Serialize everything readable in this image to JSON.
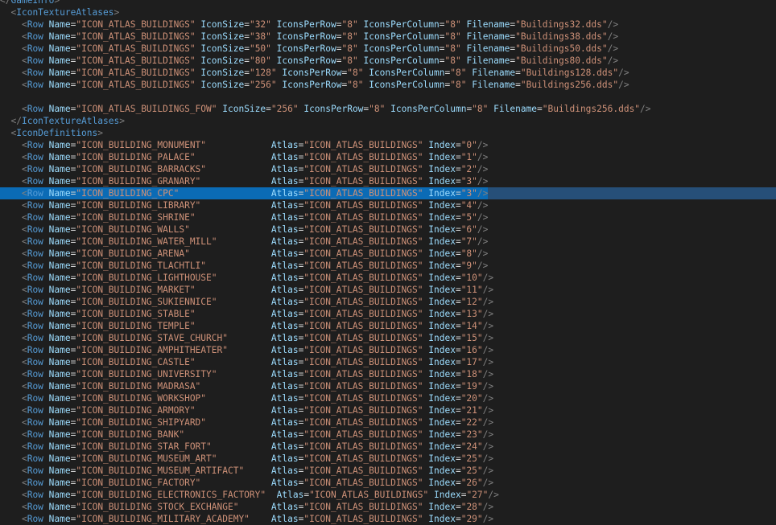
{
  "lines": [
    {
      "indent": 0,
      "close": true,
      "tag": "GameInfo",
      "attrs": []
    },
    {
      "indent": 1,
      "close": false,
      "tag": "IconTextureAtlases",
      "attrs": []
    },
    {
      "indent": 2,
      "self": true,
      "tag": "Row",
      "attrs": [
        {
          "name": "Name",
          "value": "ICON_ATLAS_BUILDINGS"
        },
        {
          "name": "IconSize",
          "value": "32"
        },
        {
          "name": "IconsPerRow",
          "value": "8"
        },
        {
          "name": "IconsPerColumn",
          "value": "8"
        },
        {
          "name": "Filename",
          "value": "Buildings32.dds"
        }
      ]
    },
    {
      "indent": 2,
      "self": true,
      "tag": "Row",
      "attrs": [
        {
          "name": "Name",
          "value": "ICON_ATLAS_BUILDINGS"
        },
        {
          "name": "IconSize",
          "value": "38"
        },
        {
          "name": "IconsPerRow",
          "value": "8"
        },
        {
          "name": "IconsPerColumn",
          "value": "8"
        },
        {
          "name": "Filename",
          "value": "Buildings38.dds"
        }
      ]
    },
    {
      "indent": 2,
      "self": true,
      "tag": "Row",
      "attrs": [
        {
          "name": "Name",
          "value": "ICON_ATLAS_BUILDINGS"
        },
        {
          "name": "IconSize",
          "value": "50"
        },
        {
          "name": "IconsPerRow",
          "value": "8"
        },
        {
          "name": "IconsPerColumn",
          "value": "8"
        },
        {
          "name": "Filename",
          "value": "Buildings50.dds"
        }
      ]
    },
    {
      "indent": 2,
      "self": true,
      "tag": "Row",
      "attrs": [
        {
          "name": "Name",
          "value": "ICON_ATLAS_BUILDINGS"
        },
        {
          "name": "IconSize",
          "value": "80"
        },
        {
          "name": "IconsPerRow",
          "value": "8"
        },
        {
          "name": "IconsPerColumn",
          "value": "8"
        },
        {
          "name": "Filename",
          "value": "Buildings80.dds"
        }
      ]
    },
    {
      "indent": 2,
      "self": true,
      "tag": "Row",
      "attrs": [
        {
          "name": "Name",
          "value": "ICON_ATLAS_BUILDINGS"
        },
        {
          "name": "IconSize",
          "value": "128"
        },
        {
          "name": "IconsPerRow",
          "value": "8"
        },
        {
          "name": "IconsPerColumn",
          "value": "8"
        },
        {
          "name": "Filename",
          "value": "Buildings128.dds"
        }
      ]
    },
    {
      "indent": 2,
      "self": true,
      "tag": "Row",
      "attrs": [
        {
          "name": "Name",
          "value": "ICON_ATLAS_BUILDINGS"
        },
        {
          "name": "IconSize",
          "value": "256"
        },
        {
          "name": "IconsPerRow",
          "value": "8"
        },
        {
          "name": "IconsPerColumn",
          "value": "8"
        },
        {
          "name": "Filename",
          "value": "Buildings256.dds"
        }
      ]
    },
    {
      "indent": 2,
      "blank": true
    },
    {
      "indent": 2,
      "self": true,
      "tag": "Row",
      "attrs": [
        {
          "name": "Name",
          "value": "ICON_ATLAS_BUILDINGS_FOW"
        },
        {
          "name": "IconSize",
          "value": "256"
        },
        {
          "name": "IconsPerRow",
          "value": "8"
        },
        {
          "name": "IconsPerColumn",
          "value": "8"
        },
        {
          "name": "Filename",
          "value": "Buildings256.dds"
        }
      ]
    },
    {
      "indent": 1,
      "close": true,
      "tag": "IconTextureAtlases",
      "attrs": []
    },
    {
      "indent": 1,
      "close": false,
      "tag": "IconDefinitions",
      "attrs": []
    },
    {
      "indent": 2,
      "self": true,
      "tag": "Row",
      "pad": 7,
      "attrs": [
        {
          "name": "Name",
          "value": "ICON_BUILDING_MONUMENT"
        },
        {
          "name": "Atlas",
          "value": "ICON_ATLAS_BUILDINGS"
        },
        {
          "name": "Index",
          "value": "0"
        }
      ]
    },
    {
      "indent": 2,
      "self": true,
      "tag": "Row",
      "pad": 7,
      "attrs": [
        {
          "name": "Name",
          "value": "ICON_BUILDING_PALACE"
        },
        {
          "name": "Atlas",
          "value": "ICON_ATLAS_BUILDINGS"
        },
        {
          "name": "Index",
          "value": "1"
        }
      ]
    },
    {
      "indent": 2,
      "self": true,
      "tag": "Row",
      "pad": 7,
      "attrs": [
        {
          "name": "Name",
          "value": "ICON_BUILDING_BARRACKS"
        },
        {
          "name": "Atlas",
          "value": "ICON_ATLAS_BUILDINGS"
        },
        {
          "name": "Index",
          "value": "2"
        }
      ]
    },
    {
      "indent": 2,
      "self": true,
      "tag": "Row",
      "pad": 7,
      "attrs": [
        {
          "name": "Name",
          "value": "ICON_BUILDING_GRANARY"
        },
        {
          "name": "Atlas",
          "value": "ICON_ATLAS_BUILDINGS"
        },
        {
          "name": "Index",
          "value": "3"
        }
      ]
    },
    {
      "indent": 2,
      "self": true,
      "tag": "Row",
      "pad": 7,
      "selected": true,
      "attrs": [
        {
          "name": "Name",
          "value": "ICON_BUILDING_CPC"
        },
        {
          "name": "Atlas",
          "value": "ICON_ATLAS_BUILDINGS"
        },
        {
          "name": "Index",
          "value": "3"
        }
      ]
    },
    {
      "indent": 2,
      "self": true,
      "tag": "Row",
      "pad": 7,
      "attrs": [
        {
          "name": "Name",
          "value": "ICON_BUILDING_LIBRARY"
        },
        {
          "name": "Atlas",
          "value": "ICON_ATLAS_BUILDINGS"
        },
        {
          "name": "Index",
          "value": "4"
        }
      ]
    },
    {
      "indent": 2,
      "self": true,
      "tag": "Row",
      "pad": 7,
      "attrs": [
        {
          "name": "Name",
          "value": "ICON_BUILDING_SHRINE"
        },
        {
          "name": "Atlas",
          "value": "ICON_ATLAS_BUILDINGS"
        },
        {
          "name": "Index",
          "value": "5"
        }
      ]
    },
    {
      "indent": 2,
      "self": true,
      "tag": "Row",
      "pad": 7,
      "attrs": [
        {
          "name": "Name",
          "value": "ICON_BUILDING_WALLS"
        },
        {
          "name": "Atlas",
          "value": "ICON_ATLAS_BUILDINGS"
        },
        {
          "name": "Index",
          "value": "6"
        }
      ]
    },
    {
      "indent": 2,
      "self": true,
      "tag": "Row",
      "pad": 7,
      "attrs": [
        {
          "name": "Name",
          "value": "ICON_BUILDING_WATER_MILL"
        },
        {
          "name": "Atlas",
          "value": "ICON_ATLAS_BUILDINGS"
        },
        {
          "name": "Index",
          "value": "7"
        }
      ]
    },
    {
      "indent": 2,
      "self": true,
      "tag": "Row",
      "pad": 7,
      "attrs": [
        {
          "name": "Name",
          "value": "ICON_BUILDING_ARENA"
        },
        {
          "name": "Atlas",
          "value": "ICON_ATLAS_BUILDINGS"
        },
        {
          "name": "Index",
          "value": "8"
        }
      ]
    },
    {
      "indent": 2,
      "self": true,
      "tag": "Row",
      "pad": 7,
      "attrs": [
        {
          "name": "Name",
          "value": "ICON_BUILDING_TLACHTLI"
        },
        {
          "name": "Atlas",
          "value": "ICON_ATLAS_BUILDINGS"
        },
        {
          "name": "Index",
          "value": "9"
        }
      ]
    },
    {
      "indent": 2,
      "self": true,
      "tag": "Row",
      "pad": 7,
      "attrs": [
        {
          "name": "Name",
          "value": "ICON_BUILDING_LIGHTHOUSE"
        },
        {
          "name": "Atlas",
          "value": "ICON_ATLAS_BUILDINGS"
        },
        {
          "name": "Index",
          "value": "10"
        }
      ]
    },
    {
      "indent": 2,
      "self": true,
      "tag": "Row",
      "pad": 7,
      "attrs": [
        {
          "name": "Name",
          "value": "ICON_BUILDING_MARKET"
        },
        {
          "name": "Atlas",
          "value": "ICON_ATLAS_BUILDINGS"
        },
        {
          "name": "Index",
          "value": "11"
        }
      ]
    },
    {
      "indent": 2,
      "self": true,
      "tag": "Row",
      "pad": 7,
      "attrs": [
        {
          "name": "Name",
          "value": "ICON_BUILDING_SUKIENNICE"
        },
        {
          "name": "Atlas",
          "value": "ICON_ATLAS_BUILDINGS"
        },
        {
          "name": "Index",
          "value": "12"
        }
      ]
    },
    {
      "indent": 2,
      "self": true,
      "tag": "Row",
      "pad": 7,
      "attrs": [
        {
          "name": "Name",
          "value": "ICON_BUILDING_STABLE"
        },
        {
          "name": "Atlas",
          "value": "ICON_ATLAS_BUILDINGS"
        },
        {
          "name": "Index",
          "value": "13"
        }
      ]
    },
    {
      "indent": 2,
      "self": true,
      "tag": "Row",
      "pad": 7,
      "attrs": [
        {
          "name": "Name",
          "value": "ICON_BUILDING_TEMPLE"
        },
        {
          "name": "Atlas",
          "value": "ICON_ATLAS_BUILDINGS"
        },
        {
          "name": "Index",
          "value": "14"
        }
      ]
    },
    {
      "indent": 2,
      "self": true,
      "tag": "Row",
      "pad": 7,
      "attrs": [
        {
          "name": "Name",
          "value": "ICON_BUILDING_STAVE_CHURCH"
        },
        {
          "name": "Atlas",
          "value": "ICON_ATLAS_BUILDINGS"
        },
        {
          "name": "Index",
          "value": "15"
        }
      ]
    },
    {
      "indent": 2,
      "self": true,
      "tag": "Row",
      "pad": 7,
      "attrs": [
        {
          "name": "Name",
          "value": "ICON_BUILDING_AMPHITHEATER"
        },
        {
          "name": "Atlas",
          "value": "ICON_ATLAS_BUILDINGS"
        },
        {
          "name": "Index",
          "value": "16"
        }
      ]
    },
    {
      "indent": 2,
      "self": true,
      "tag": "Row",
      "pad": 7,
      "attrs": [
        {
          "name": "Name",
          "value": "ICON_BUILDING_CASTLE"
        },
        {
          "name": "Atlas",
          "value": "ICON_ATLAS_BUILDINGS"
        },
        {
          "name": "Index",
          "value": "17"
        }
      ]
    },
    {
      "indent": 2,
      "self": true,
      "tag": "Row",
      "pad": 7,
      "attrs": [
        {
          "name": "Name",
          "value": "ICON_BUILDING_UNIVERSITY"
        },
        {
          "name": "Atlas",
          "value": "ICON_ATLAS_BUILDINGS"
        },
        {
          "name": "Index",
          "value": "18"
        }
      ]
    },
    {
      "indent": 2,
      "self": true,
      "tag": "Row",
      "pad": 7,
      "attrs": [
        {
          "name": "Name",
          "value": "ICON_BUILDING_MADRASA"
        },
        {
          "name": "Atlas",
          "value": "ICON_ATLAS_BUILDINGS"
        },
        {
          "name": "Index",
          "value": "19"
        }
      ]
    },
    {
      "indent": 2,
      "self": true,
      "tag": "Row",
      "pad": 7,
      "attrs": [
        {
          "name": "Name",
          "value": "ICON_BUILDING_WORKSHOP"
        },
        {
          "name": "Atlas",
          "value": "ICON_ATLAS_BUILDINGS"
        },
        {
          "name": "Index",
          "value": "20"
        }
      ]
    },
    {
      "indent": 2,
      "self": true,
      "tag": "Row",
      "pad": 7,
      "attrs": [
        {
          "name": "Name",
          "value": "ICON_BUILDING_ARMORY"
        },
        {
          "name": "Atlas",
          "value": "ICON_ATLAS_BUILDINGS"
        },
        {
          "name": "Index",
          "value": "21"
        }
      ]
    },
    {
      "indent": 2,
      "self": true,
      "tag": "Row",
      "pad": 7,
      "attrs": [
        {
          "name": "Name",
          "value": "ICON_BUILDING_SHIPYARD"
        },
        {
          "name": "Atlas",
          "value": "ICON_ATLAS_BUILDINGS"
        },
        {
          "name": "Index",
          "value": "22"
        }
      ]
    },
    {
      "indent": 2,
      "self": true,
      "tag": "Row",
      "pad": 7,
      "attrs": [
        {
          "name": "Name",
          "value": "ICON_BUILDING_BANK"
        },
        {
          "name": "Atlas",
          "value": "ICON_ATLAS_BUILDINGS"
        },
        {
          "name": "Index",
          "value": "23"
        }
      ]
    },
    {
      "indent": 2,
      "self": true,
      "tag": "Row",
      "pad": 7,
      "attrs": [
        {
          "name": "Name",
          "value": "ICON_BUILDING_STAR_FORT"
        },
        {
          "name": "Atlas",
          "value": "ICON_ATLAS_BUILDINGS"
        },
        {
          "name": "Index",
          "value": "24"
        }
      ]
    },
    {
      "indent": 2,
      "self": true,
      "tag": "Row",
      "pad": 7,
      "attrs": [
        {
          "name": "Name",
          "value": "ICON_BUILDING_MUSEUM_ART"
        },
        {
          "name": "Atlas",
          "value": "ICON_ATLAS_BUILDINGS"
        },
        {
          "name": "Index",
          "value": "25"
        }
      ]
    },
    {
      "indent": 2,
      "self": true,
      "tag": "Row",
      "pad": 7,
      "attrs": [
        {
          "name": "Name",
          "value": "ICON_BUILDING_MUSEUM_ARTIFACT"
        },
        {
          "name": "Atlas",
          "value": "ICON_ATLAS_BUILDINGS"
        },
        {
          "name": "Index",
          "value": "25"
        }
      ]
    },
    {
      "indent": 2,
      "self": true,
      "tag": "Row",
      "pad": 7,
      "attrs": [
        {
          "name": "Name",
          "value": "ICON_BUILDING_FACTORY"
        },
        {
          "name": "Atlas",
          "value": "ICON_ATLAS_BUILDINGS"
        },
        {
          "name": "Index",
          "value": "26"
        }
      ]
    },
    {
      "indent": 2,
      "self": true,
      "tag": "Row",
      "pad": 7,
      "attrs": [
        {
          "name": "Name",
          "value": "ICON_BUILDING_ELECTRONICS_FACTORY"
        },
        {
          "name": "Atlas",
          "value": "ICON_ATLAS_BUILDINGS"
        },
        {
          "name": "Index",
          "value": "27"
        }
      ]
    },
    {
      "indent": 2,
      "self": true,
      "tag": "Row",
      "pad": 7,
      "attrs": [
        {
          "name": "Name",
          "value": "ICON_BUILDING_STOCK_EXCHANGE"
        },
        {
          "name": "Atlas",
          "value": "ICON_ATLAS_BUILDINGS"
        },
        {
          "name": "Index",
          "value": "28"
        }
      ]
    },
    {
      "indent": 2,
      "self": true,
      "tag": "Row",
      "pad": 7,
      "attrs": [
        {
          "name": "Name",
          "value": "ICON_BUILDING_MILITARY_ACADEMY"
        },
        {
          "name": "Atlas",
          "value": "ICON_ATLAS_BUILDINGS"
        },
        {
          "name": "Index",
          "value": "29"
        }
      ]
    }
  ]
}
